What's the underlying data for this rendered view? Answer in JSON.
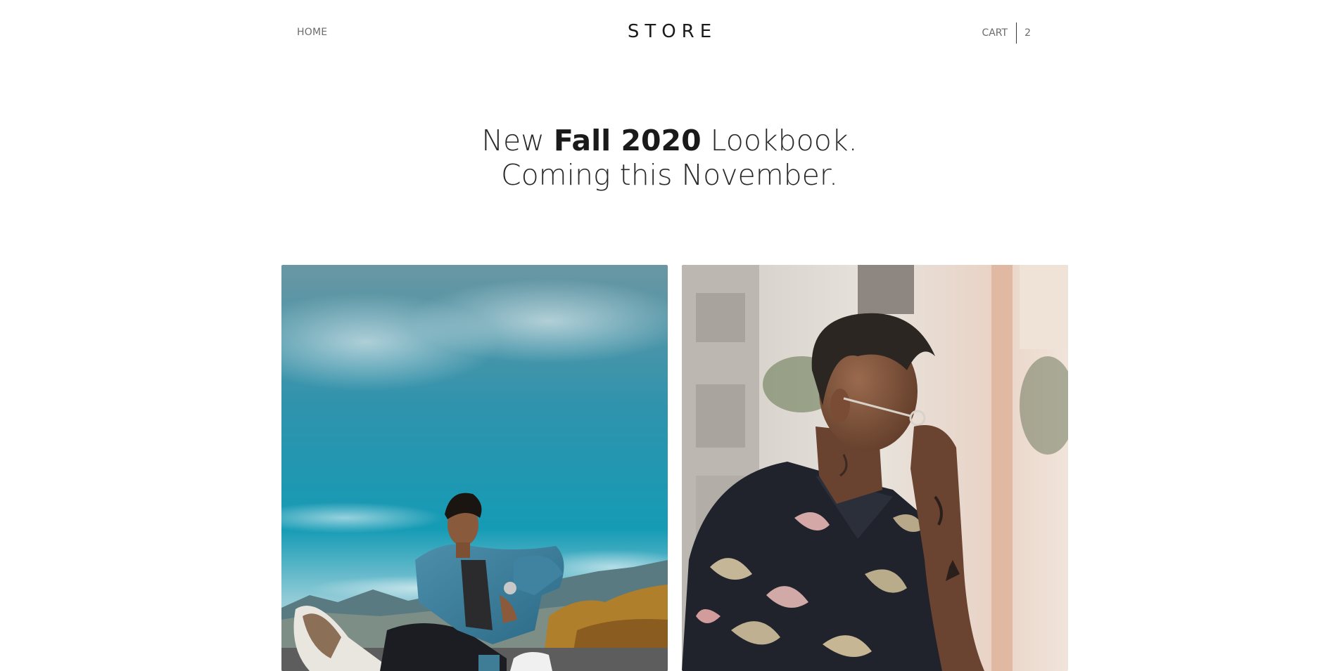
{
  "header": {
    "home_label": "HOME",
    "brand": "STORE",
    "cart_label": "CART",
    "cart_count": "2"
  },
  "hero": {
    "line1_pre": "New ",
    "line1_bold": "Fall 2020",
    "line1_post": " Lookbook.",
    "line2": "Coming this November."
  },
  "colors": {
    "sky_top": "#5f97a6",
    "sky_mid": "#1f9ab3",
    "sky_low": "#7cc3d2",
    "denim": "#3d7e9a",
    "shirt_dark": "#1d1f27",
    "wall_light": "#e6e2dc"
  },
  "lookbook": {
    "cards": [
      {
        "name": "lookbook-photo-denim-sky"
      },
      {
        "name": "lookbook-photo-floral-shirt"
      }
    ]
  }
}
